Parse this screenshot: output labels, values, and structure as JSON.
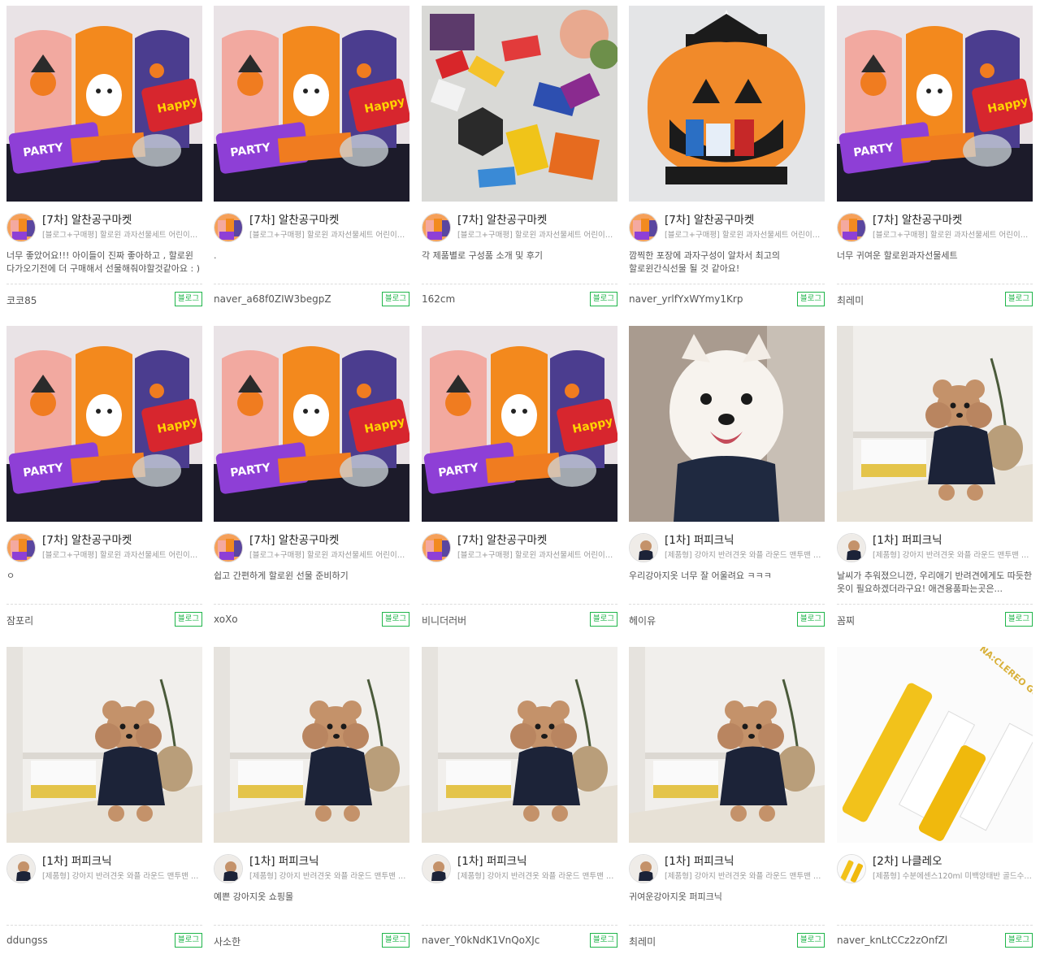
{
  "products": {
    "halloween": {
      "title": "[7차] 알찬공구마켓",
      "desc": "[블로그+구매평] 할로윈 과자선물세트 어린이집 유..."
    },
    "poodle": {
      "title": "[1차] 퍼피크닉",
      "desc": "[제품형] 강아지 반려견옷 와플 라운드 맨투맨 티셔츠"
    },
    "serum": {
      "title": "[2차] 나클레오",
      "desc": "[제품형] 수분에센스120ml 미백앙태반 골드수분..."
    }
  },
  "blog_label": "블로그",
  "cards": [
    {
      "product": "halloween",
      "img": "halloween",
      "review": [
        "너무 좋았어요!!! 아이들이 진짜 좋아하고 , 할로윈",
        "다가오기전에 더 구매해서 선물해줘야할것같아요 : )"
      ],
      "user": "코코85"
    },
    {
      "product": "halloween",
      "img": "halloween",
      "review": [
        "."
      ],
      "user": "naver_a68f0ZIW3begpZ"
    },
    {
      "product": "halloween",
      "img": "snacks",
      "review": [
        "각 제품별로 구성품 소개 및 후기"
      ],
      "user": "162cm"
    },
    {
      "product": "halloween",
      "img": "pumpkin",
      "review": [
        "깜찍한 포장에 과자구성이 알차서 최고의",
        "할로윈간식선물 될 것 같아요!"
      ],
      "user": "naver_yrlfYxWYmy1Krp"
    },
    {
      "product": "halloween",
      "img": "halloween",
      "review": [
        "너무 귀여운 할로윈과자선물세트"
      ],
      "user": "최레미"
    },
    {
      "product": "halloween",
      "img": "halloween",
      "review": [
        "ㅇ"
      ],
      "user": "잠포리"
    },
    {
      "product": "halloween",
      "img": "halloween",
      "review": [
        "쉽고 간편하게 할로윈 선물 준비하기"
      ],
      "user": "xoXo"
    },
    {
      "product": "halloween",
      "img": "halloween",
      "review": [
        ""
      ],
      "user": "비니더러버"
    },
    {
      "product": "poodle",
      "img": "whitedog",
      "review": [
        "우리강아지옷 너무 잘 어울려요 ㅋㅋㅋ"
      ],
      "user": "헤이유"
    },
    {
      "product": "poodle",
      "img": "poodle",
      "review": [
        "날씨가 추워졌으니깐, 우리애기 반려견에게도 따듯한",
        "옷이 필요하겠더라구요! 애견용품파는곳은..."
      ],
      "user": "꼼찌"
    },
    {
      "product": "poodle",
      "img": "poodle",
      "review": [
        ""
      ],
      "user": "ddungss"
    },
    {
      "product": "poodle",
      "img": "poodle",
      "review": [
        "예쁜 강아지옷 쇼핑몰"
      ],
      "user": "사소한"
    },
    {
      "product": "poodle",
      "img": "poodle",
      "review": [
        ""
      ],
      "user": "naver_Y0kNdK1VnQoXJc"
    },
    {
      "product": "poodle",
      "img": "poodle",
      "review": [
        "귀여운강아지옷 퍼피크닉"
      ],
      "user": "최레미"
    },
    {
      "product": "serum",
      "img": "serum",
      "review": [
        ""
      ],
      "user": "naver_knLtCCz2zOnfZl"
    }
  ]
}
